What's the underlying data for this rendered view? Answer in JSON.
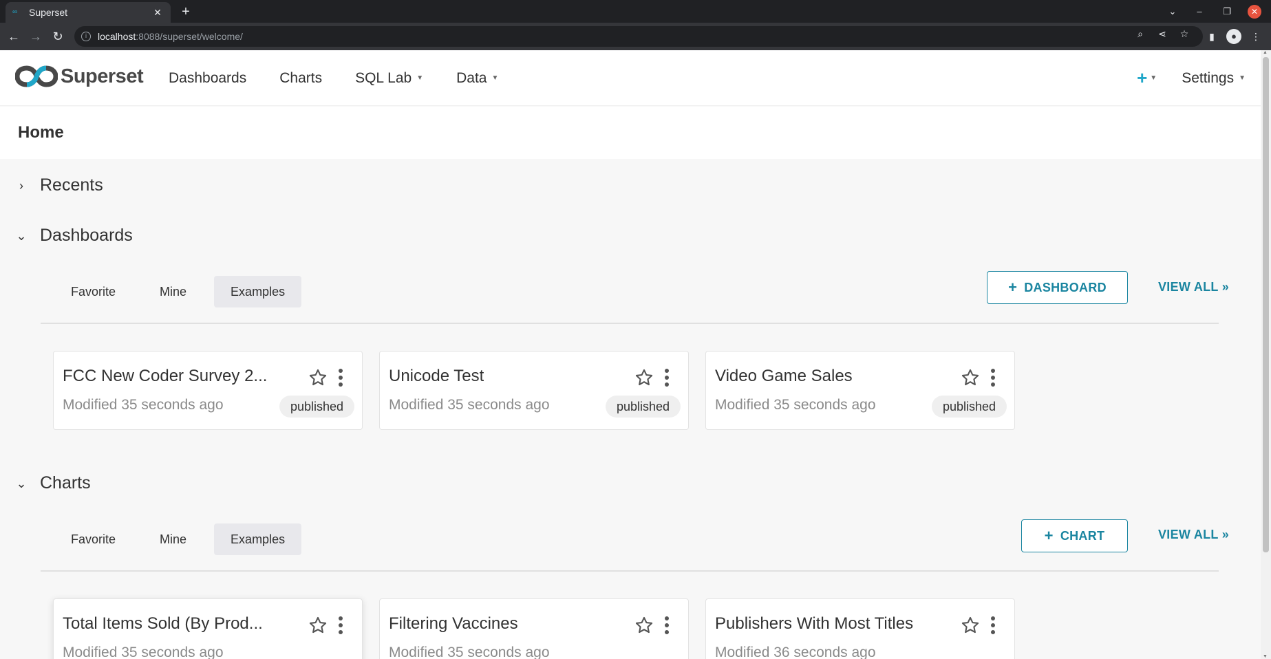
{
  "browser": {
    "tab_title": "Superset",
    "url_host": "localhost",
    "url_rest": ":8088/superset/welcome/"
  },
  "header": {
    "brand": "Superset",
    "nav": [
      {
        "label": "Dashboards"
      },
      {
        "label": "Charts"
      },
      {
        "label": "SQL Lab"
      },
      {
        "label": "Data"
      }
    ],
    "plus_label": "+",
    "settings_label": "Settings"
  },
  "page": {
    "title": "Home"
  },
  "recents": {
    "title": "Recents"
  },
  "dashboards": {
    "title": "Dashboards",
    "tabs": [
      "Favorite",
      "Mine",
      "Examples"
    ],
    "active_tab": "Examples",
    "add_label": "DASHBOARD",
    "view_all": "VIEW ALL »",
    "cards": [
      {
        "title": "FCC New Coder Survey 2...",
        "modified": "Modified 35 seconds ago",
        "status": "published"
      },
      {
        "title": "Unicode Test",
        "modified": "Modified 35 seconds ago",
        "status": "published"
      },
      {
        "title": "Video Game Sales",
        "modified": "Modified 35 seconds ago",
        "status": "published"
      }
    ]
  },
  "charts": {
    "title": "Charts",
    "tabs": [
      "Favorite",
      "Mine",
      "Examples"
    ],
    "active_tab": "Examples",
    "add_label": "CHART",
    "view_all": "VIEW ALL »",
    "cards": [
      {
        "title": "Total Items Sold (By Prod...",
        "modified": "Modified 35 seconds ago"
      },
      {
        "title": "Filtering Vaccines",
        "modified": "Modified 35 seconds ago"
      },
      {
        "title": "Publishers With Most Titles",
        "modified": "Modified 36 seconds ago"
      }
    ]
  },
  "colors": {
    "brand_primary": "#20a7c9",
    "link": "#1a85a0",
    "logo_dark": "#484848"
  }
}
